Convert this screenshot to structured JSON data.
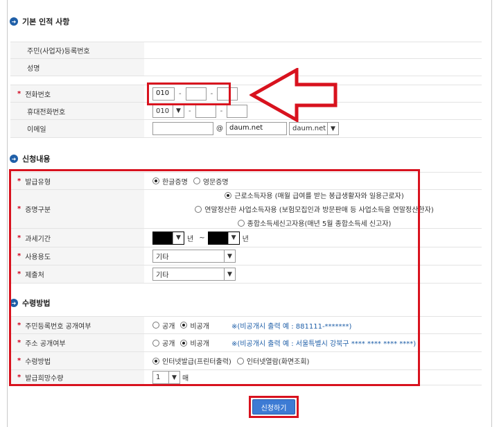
{
  "sections": {
    "basic": "기본 인적 사항",
    "apply": "신청내용",
    "receive": "수령방법"
  },
  "basic": {
    "rrn_label": "주민(사업자)등록번호",
    "name_label": "성명",
    "phone_label": "전화번호",
    "phone_prefix": "010",
    "mobile_label": "휴대전화번호",
    "mobile_prefix": "010",
    "email_label": "이메일",
    "email_at": "@",
    "email_domain": "daum.net",
    "email_domain_select": "daum.net"
  },
  "apply": {
    "issue_type_label": "발급유형",
    "issue_type_options": [
      "한글증명",
      "영문증명"
    ],
    "cert_type_label": "증명구분",
    "cert_type_options": [
      "근로소득자용 (매월 급여를 받는 봉급생활자와 일용근로자)",
      "연말정산한 사업소득자용 (보험모집인과 방문판매 등 사업소득을 연말정산한자)",
      "종합소득세신고자용(매년 5월 종합소득세 신고자)"
    ],
    "period_label": "과세기간",
    "year_unit": "년",
    "tilde": "~",
    "usage_label": "사용용도",
    "usage_value": "기타",
    "submit_to_label": "제출처",
    "submit_to_value": "기타"
  },
  "receive": {
    "rrn_public_label": "주민등록번호 공개여부",
    "public": "공개",
    "private": "비공개",
    "rrn_note": "※(비공개시 출력 예 : 881111-*******)",
    "addr_public_label": "주소 공개여부",
    "addr_note": "※(비공개시 출력 예 : 서울특별시 강북구 **** **** **** ****)",
    "method_label": "수령방법",
    "method_options": [
      "인터넷발급(프린터출력)",
      "인터넷열람(화면조회)"
    ],
    "copies_label": "발급희망수량",
    "copies_value": "1",
    "copies_unit": "매"
  },
  "submit_label": "신청하기",
  "colors": {
    "highlight": "#d8121e",
    "accent": "#1f5fa8",
    "button": "#3d7bd4"
  }
}
